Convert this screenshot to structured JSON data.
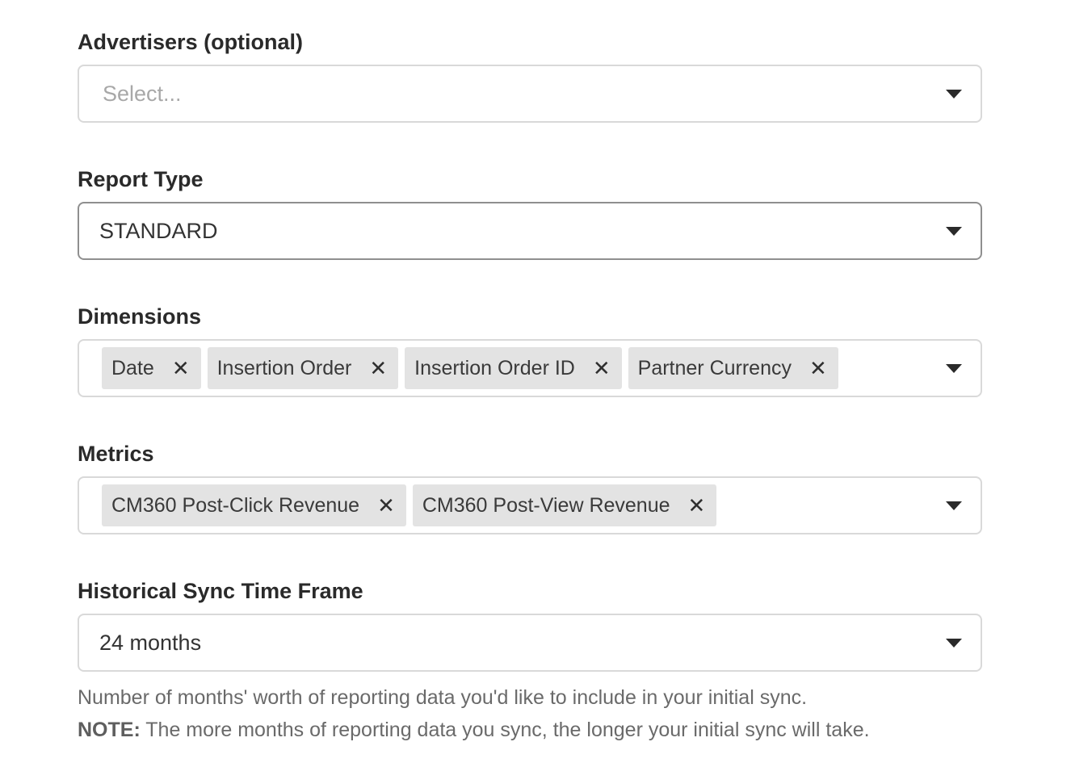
{
  "advertisers": {
    "label": "Advertisers (optional)",
    "placeholder": "Select..."
  },
  "report_type": {
    "label": "Report Type",
    "value": "STANDARD"
  },
  "dimensions": {
    "label": "Dimensions",
    "chips": [
      "Date",
      "Insertion Order",
      "Insertion Order ID",
      "Partner Currency"
    ]
  },
  "metrics": {
    "label": "Metrics",
    "chips": [
      "CM360 Post-Click Revenue",
      "CM360 Post-View Revenue"
    ]
  },
  "historical_sync": {
    "label": "Historical Sync Time Frame",
    "value": "24 months",
    "help_text": "Number of months' worth of reporting data you'd like to include in your initial sync.",
    "note_label": "NOTE:",
    "note_text": " The more months of reporting data you sync, the longer your initial sync will take."
  },
  "icons": {
    "remove": "close-icon",
    "dropdown": "caret-down-icon"
  },
  "colors": {
    "field_border": "#d9d9d9",
    "focused_border": "#8f8f8f",
    "chip_background": "#e3e3e3"
  }
}
